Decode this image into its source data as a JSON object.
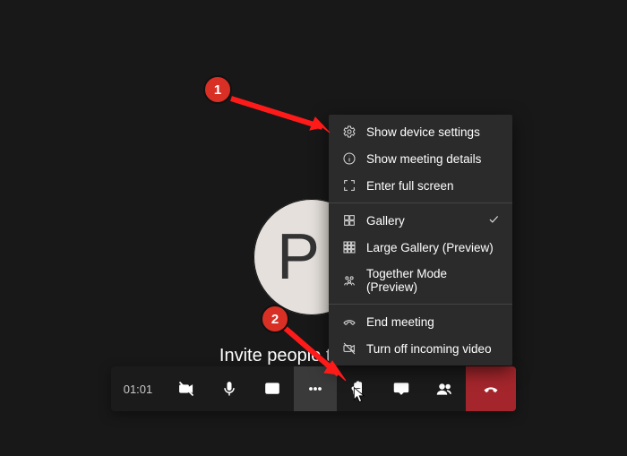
{
  "avatar": {
    "initial": "P"
  },
  "invite": {
    "text": "Invite people to join you"
  },
  "toolbar": {
    "timer": "01:01",
    "camera_off": "camera-off",
    "mic": "microphone",
    "share": "share-screen",
    "more": "more-actions",
    "raise_hand": "raise-hand",
    "chat": "chat",
    "people": "show-participants",
    "hangup": "hang-up"
  },
  "menu": {
    "items": [
      {
        "label": "Show device settings"
      },
      {
        "label": "Show meeting details"
      },
      {
        "label": "Enter full screen"
      }
    ],
    "view_items": [
      {
        "label": "Gallery",
        "checked": true
      },
      {
        "label": "Large Gallery (Preview)"
      },
      {
        "label": "Together Mode (Preview)"
      }
    ],
    "bottom_items": [
      {
        "label": "End meeting"
      },
      {
        "label": "Turn off incoming video"
      }
    ]
  },
  "annotations": {
    "badge1": "1",
    "badge2": "2"
  }
}
